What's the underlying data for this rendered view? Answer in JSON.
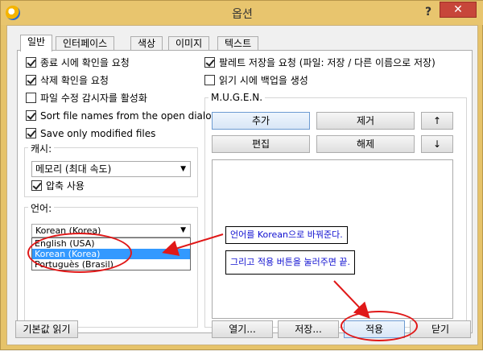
{
  "window": {
    "title": "옵션",
    "help": "?",
    "close": "✕"
  },
  "tabs": [
    "일반",
    "인터페이스",
    "색상",
    "이미지",
    "텍스트"
  ],
  "left_checks": [
    {
      "label": "종료 시에 확인을 요청",
      "checked": true
    },
    {
      "label": "삭제 확인을 요청",
      "checked": true
    },
    {
      "label": "파일 수정 감시자를 활성화",
      "checked": false
    },
    {
      "label": "Sort file names from the open dialog",
      "checked": true
    },
    {
      "label": "Save only modified files",
      "checked": true
    }
  ],
  "right_checks": [
    {
      "label": "팔레트 저장을 요청 (파일: 저장 / 다른 이름으로 저장)",
      "checked": true
    },
    {
      "label": "읽기 시에 백업을 생성",
      "checked": false
    }
  ],
  "cache": {
    "label": "캐시:",
    "combo_value": "메모리 (최대 속도)",
    "compress_label": "압축 사용",
    "compress_checked": true
  },
  "language": {
    "label": "언어:",
    "combo_value": "Korean (Korea)",
    "options": [
      "English (USA)",
      "Korean (Korea)",
      "Portuguès (Brasil)"
    ],
    "selected_index": 1
  },
  "mugen": {
    "label": "M.U.G.E.N.",
    "add": "추가",
    "remove": "제거",
    "up": "↑",
    "edit": "편집",
    "release": "해제",
    "down": "↓"
  },
  "bottom": {
    "defaults": "기본값 읽기",
    "open": "열기...",
    "save": "저장...",
    "apply": "적용",
    "close": "닫기"
  },
  "annotations": {
    "note1": "언어를 Korean으로 바꿔준다.",
    "note2": "그리고 적용 버튼을 눌러주면 끝."
  },
  "colors": {
    "annotation_red": "#e01818",
    "annotation_text": "#1010d0",
    "selection": "#3399ff"
  }
}
